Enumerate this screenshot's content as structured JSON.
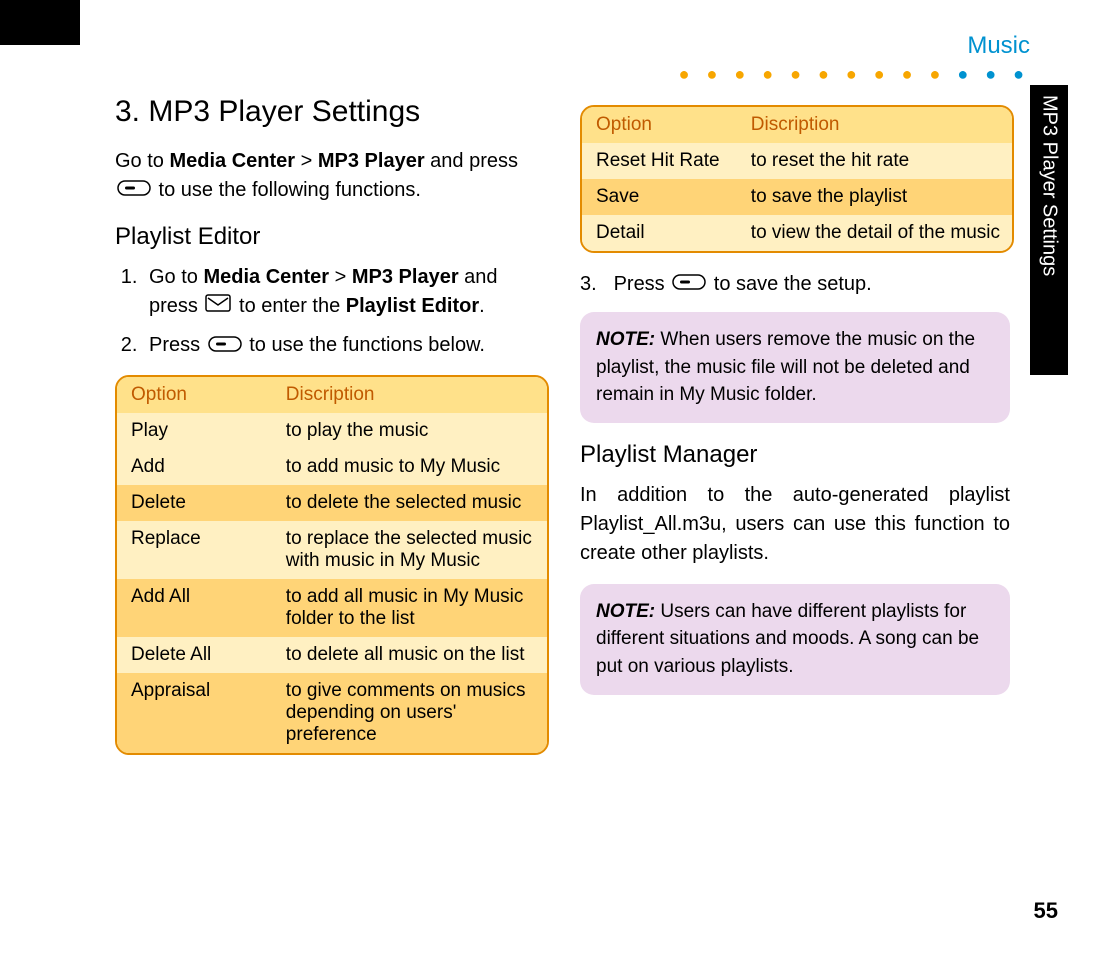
{
  "section_label": "Music",
  "side_tab": "MP3 Player Settings",
  "page_number": "55",
  "main_title": "3. MP3 Player Settings",
  "intro": {
    "pre": "Go to ",
    "b1": "Media Center",
    "sep": " > ",
    "b2": "MP3 Player",
    "mid": " and press ",
    "post": " to use the following functions."
  },
  "sub1": "Playlist Editor",
  "steps1": {
    "s1": {
      "pre": "Go to ",
      "b1": "Media Center",
      "sep": " > ",
      "b2": "MP3 Player",
      "mid": " and press ",
      "post": " to enter the ",
      "b3": "Playlist Editor",
      "end": "."
    },
    "s2": {
      "pre": "Press ",
      "post": " to use the functions below."
    }
  },
  "t1_header": {
    "c1": "Option",
    "c2": "Discription"
  },
  "t1": {
    "r0": {
      "c1": "Play",
      "c2": "to play the music"
    },
    "r1": {
      "c1": "Add",
      "c2": "to add music to My Music"
    },
    "r2": {
      "c1": "Delete",
      "c2": "to delete the selected music"
    },
    "r3": {
      "c1": "Replace",
      "c2": "to replace the selected music with music in My Music"
    },
    "r4": {
      "c1": "Add All",
      "c2": "to add all music in My Music folder to the list"
    },
    "r5": {
      "c1": "Delete All",
      "c2": "to delete all music on the list"
    },
    "r6": {
      "c1": "Appraisal",
      "c2": "to give comments on musics depending on users' preference"
    }
  },
  "t2_header": {
    "c1": "Option",
    "c2": "Discription"
  },
  "t2": {
    "r0": {
      "c1": "Reset Hit Rate",
      "c2": "to reset the hit rate"
    },
    "r1": {
      "c1": "Save",
      "c2": "to save the playlist"
    },
    "r2": {
      "c1": "Detail",
      "c2": "to view the detail of the music"
    }
  },
  "step3": {
    "num": "3.",
    "pre": "Press ",
    "post": " to save the setup."
  },
  "note1": {
    "label": "NOTE:",
    "text": " When users remove the music on the playlist, the music file will not be deleted and remain in My Music folder."
  },
  "sub2": "Playlist Manager",
  "para2": "In addition to the auto-generated playlist Playlist_All.m3u, users can use this function to create other playlists.",
  "note2": {
    "label": "NOTE:",
    "text": " Users can have different playlists for different situations and moods. A song can be put on various playlists."
  }
}
